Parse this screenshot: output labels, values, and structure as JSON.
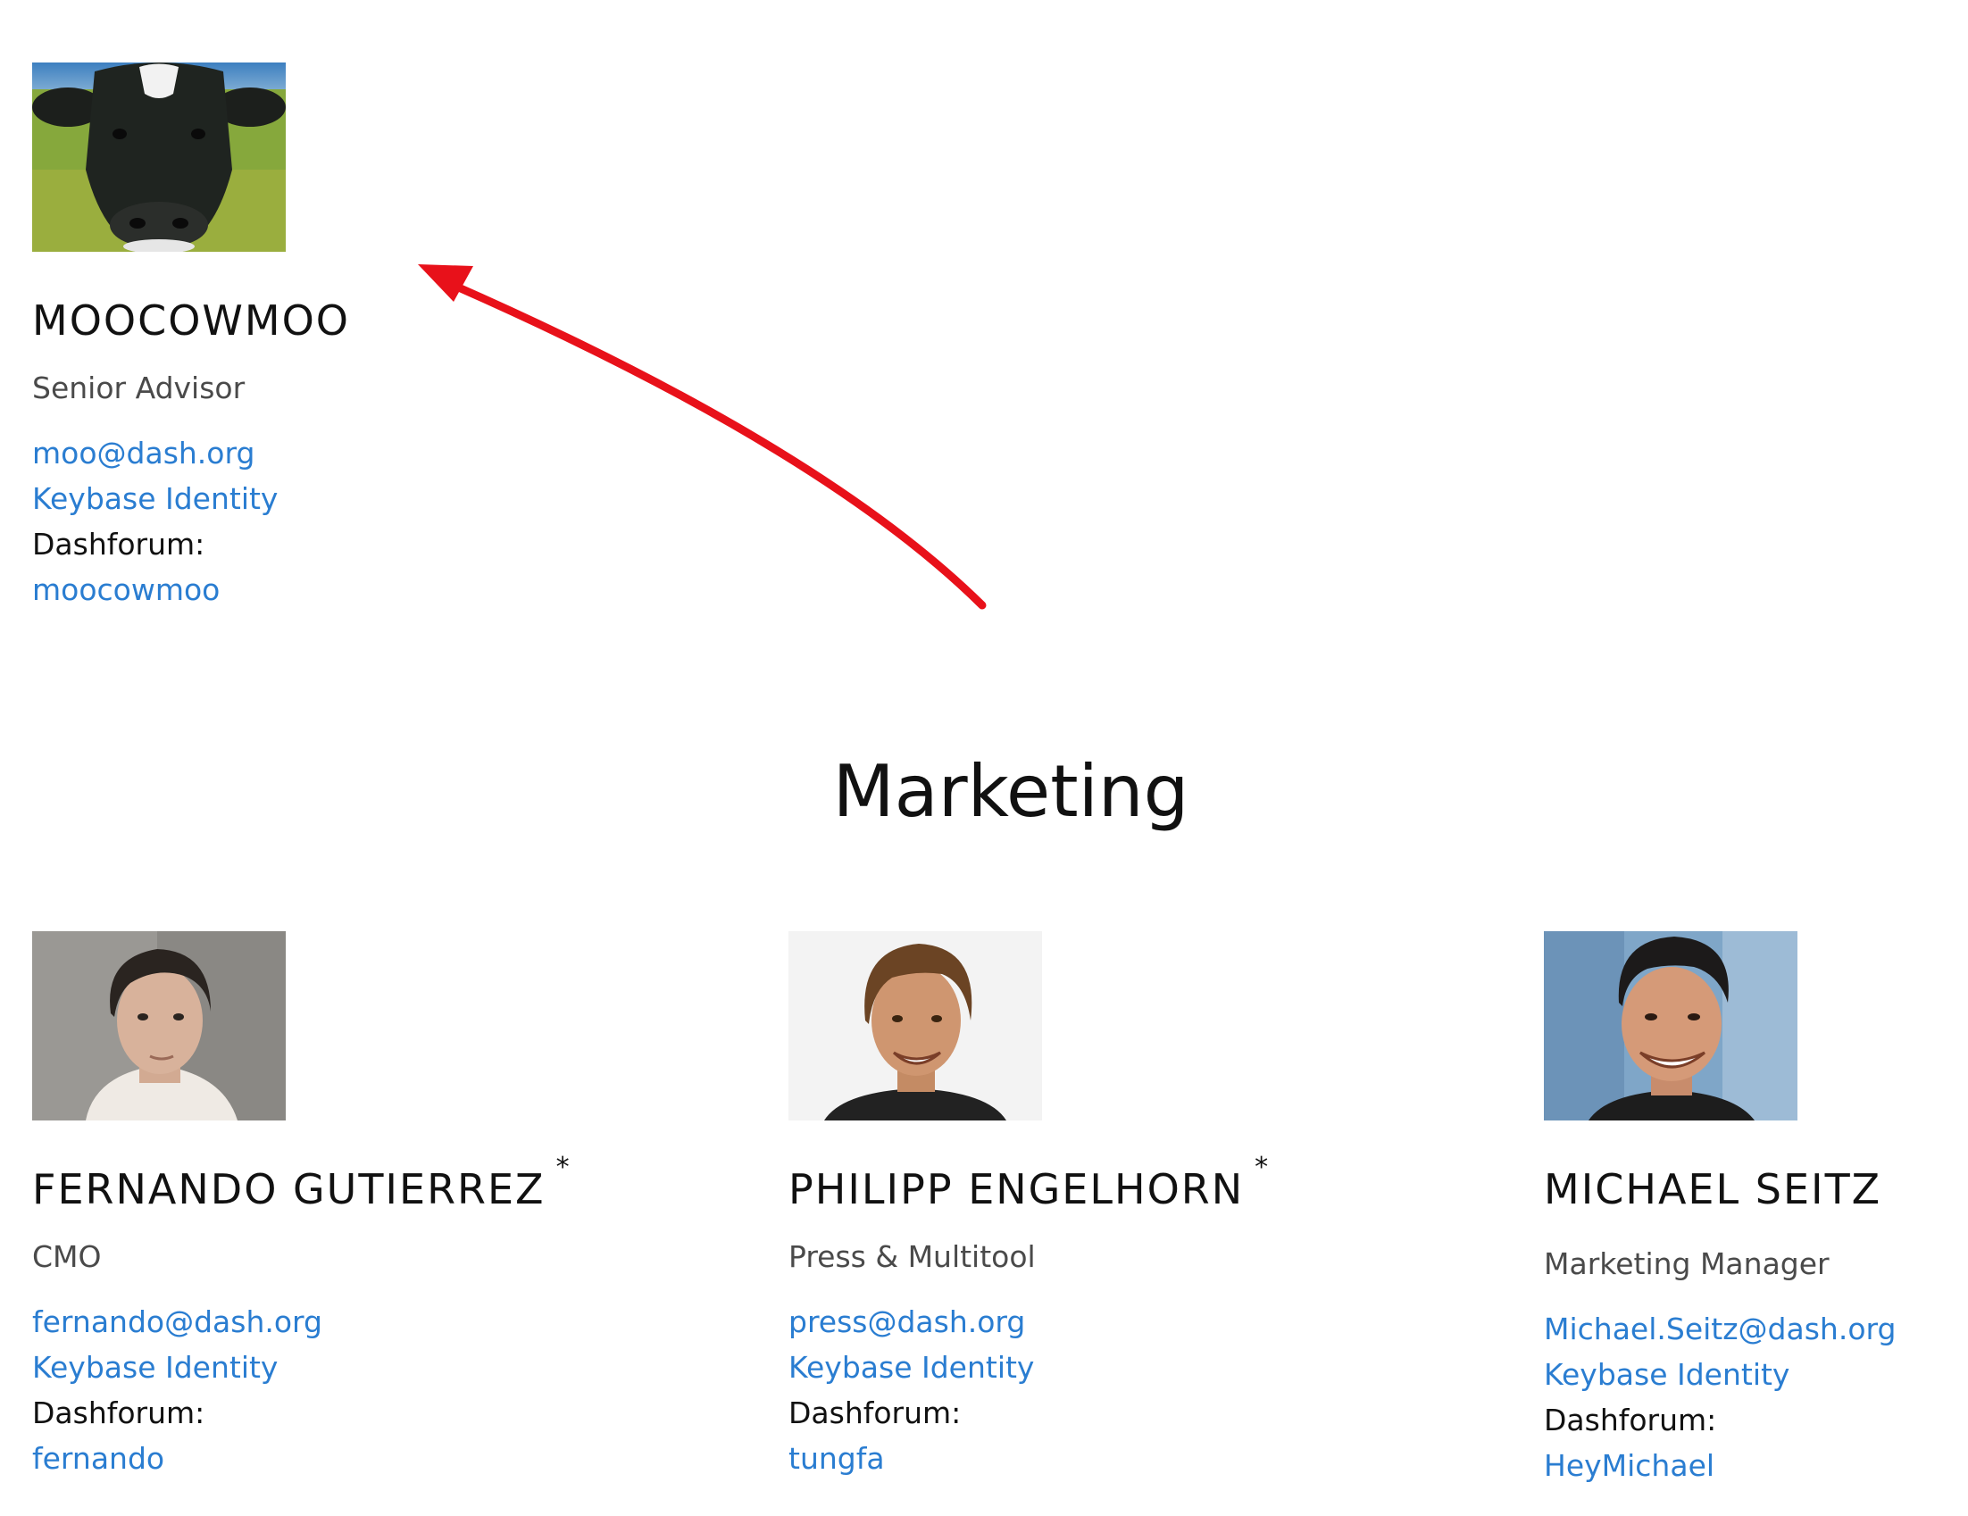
{
  "advisor": {
    "name": "MOOCOWMOO",
    "role": "Senior Advisor",
    "email": "moo@dash.org",
    "keybase": "Keybase Identity",
    "forum_label": "Dashforum:",
    "forum_handle": "moocowmoo",
    "photo_icon": "cow-photo"
  },
  "section": {
    "title": "Marketing"
  },
  "marketing": [
    {
      "name": "FERNANDO GUTIERREZ",
      "star": "*",
      "role": "CMO",
      "email": "fernando@dash.org",
      "keybase": "Keybase Identity",
      "forum_label": "Dashforum:",
      "forum_handle": "fernando"
    },
    {
      "name": "PHILIPP ENGELHORN",
      "star": "*",
      "role": "Press & Multitool",
      "email": "press@dash.org",
      "keybase": "Keybase Identity",
      "forum_label": "Dashforum:",
      "forum_handle": "tungfa"
    },
    {
      "name": "MICHAEL SEITZ",
      "role": "Marketing Manager",
      "email": "Michael.Seitz@dash.org",
      "keybase": "Keybase Identity",
      "forum_label": "Dashforum:",
      "forum_handle": "HeyMichael"
    }
  ],
  "colors": {
    "link": "#2a7dd1",
    "annotation_arrow": "#e8111a"
  }
}
